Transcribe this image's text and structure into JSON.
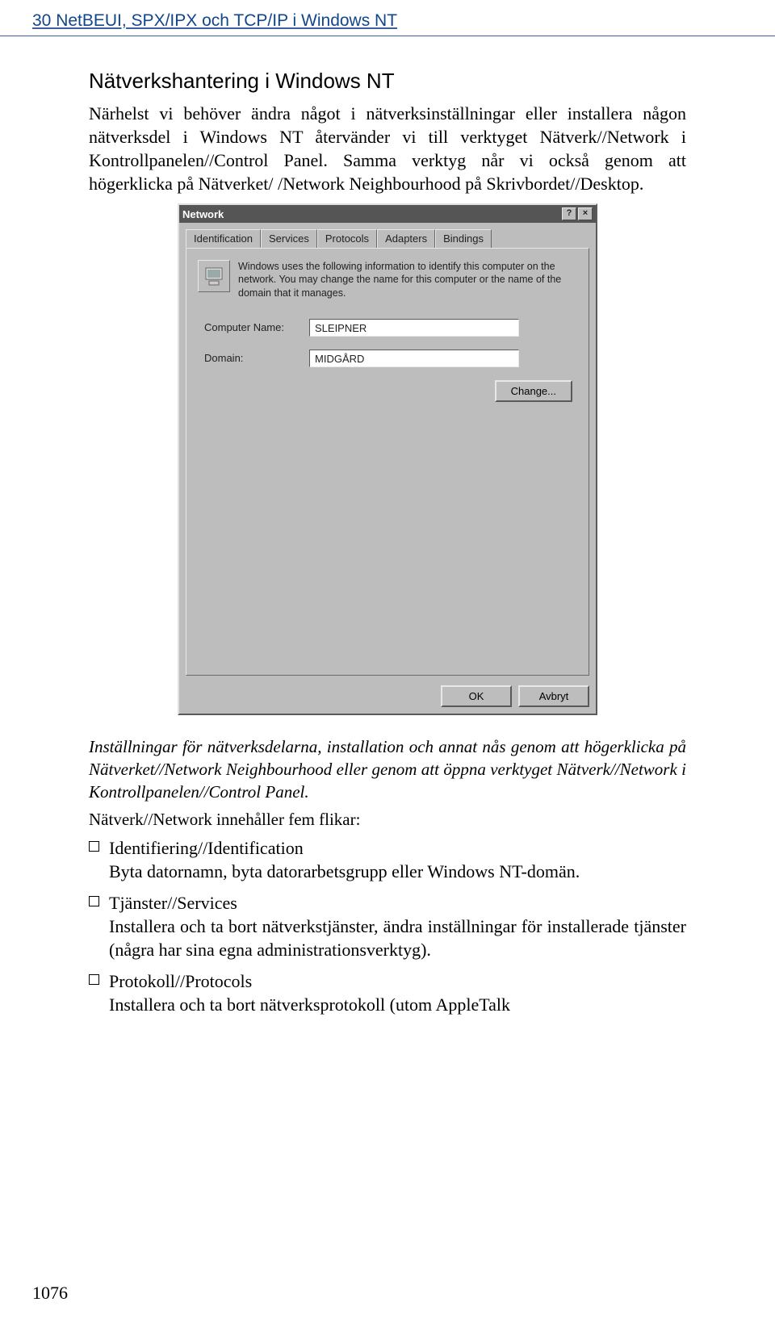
{
  "header": {
    "chapter_line": "30  NetBEUI, SPX/IPX och TCP/IP i Windows NT"
  },
  "section": {
    "title": "Nätverkshantering i Windows NT",
    "para1": "Närhelst vi behöver ändra något i nätverksinställningar eller installera någon nätverksdel i Windows NT återvänder vi till verktyget Nätverk//Network i Kontrollpanelen//Control Panel. Samma verktyg når vi också genom att högerklicka på Nätverket/ /Network Neighbourhood på Skrivbordet//Desktop."
  },
  "dialog": {
    "title": "Network",
    "help_glyph": "?",
    "close_glyph": "×",
    "tabs": {
      "identification": "Identification",
      "services": "Services",
      "protocols": "Protocols",
      "adapters": "Adapters",
      "bindings": "Bindings"
    },
    "info_text": "Windows uses the following information to identify this computer on the network. You may change the name for this computer or the name of the domain that it manages.",
    "computer_name_label": "Computer Name:",
    "computer_name_value": "SLEIPNER",
    "domain_label": "Domain:",
    "domain_value": "MIDGÅRD",
    "change_btn": "Change...",
    "ok_btn": "OK",
    "cancel_btn": "Avbryt"
  },
  "caption": {
    "para": "Inställningar för nätverksdelarna, installation och annat nås genom att högerklicka på Nätverket//Network Neighbourhood eller genom att öppna verktyget Nätverk//Network i Kontrollpanelen//Control Panel.",
    "subline": "Nätverk//Network innehåller fem flikar:"
  },
  "bullets": [
    {
      "title": "Identifiering//Identification",
      "body": "Byta datornamn, byta datorarbetsgrupp eller Windows NT-domän."
    },
    {
      "title": "Tjänster//Services",
      "body": "Installera och ta bort nätverkstjänster, ändra inställningar för installerade tjänster (några har sina egna administrationsverktyg)."
    },
    {
      "title": "Protokoll//Protocols",
      "body": "Installera och ta bort nätverksprotokoll (utom AppleTalk"
    }
  ],
  "page_number": "1076"
}
